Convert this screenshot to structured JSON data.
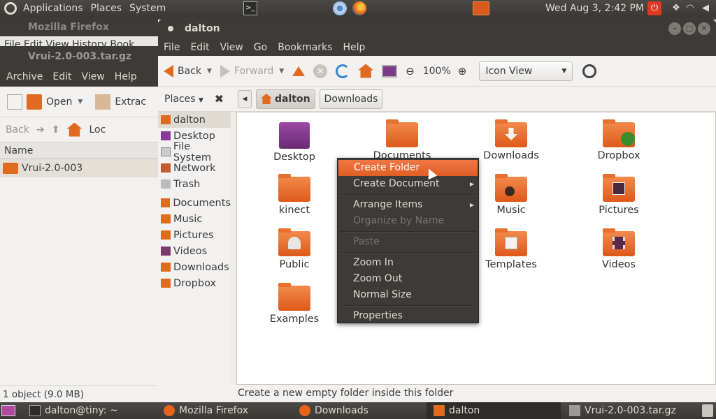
{
  "top_panel": {
    "menus": [
      "Applications",
      "Places",
      "System"
    ],
    "clock": "Wed Aug  3,  2:42 PM",
    "terminal_glyph": ">_",
    "power_glyph": "⏻",
    "tray": [
      "dropbox-icon",
      "wifi-icon",
      "volume-icon"
    ]
  },
  "bg_firefox": {
    "title": "Mozilla Firefox",
    "menu_peek": "File  Edit  View  History  Book"
  },
  "archive": {
    "title": "Vrui-2.0-003.tar.gz",
    "menus": [
      "Archive",
      "Edit",
      "View",
      "Help"
    ],
    "open_label": "Open",
    "extract_label": "Extrac",
    "back_label": "Back",
    "location_label": "Loc",
    "column_name": "Name",
    "row_name": "Vrui-2.0-003",
    "status": "1 object (9.0 MB)"
  },
  "window": {
    "title": "dalton",
    "menus": [
      "File",
      "Edit",
      "View",
      "Go",
      "Bookmarks",
      "Help"
    ],
    "toolbar": {
      "back": "Back",
      "forward": "Forward",
      "zoom": "100%",
      "view_mode": "Icon View"
    },
    "places_label": "Places",
    "breadcrumbs": [
      "dalton",
      "Downloads"
    ],
    "sidebar": [
      {
        "label": "dalton",
        "selected": true
      },
      {
        "label": "Desktop"
      },
      {
        "label": "File System"
      },
      {
        "label": "Network"
      },
      {
        "label": "Trash"
      },
      {
        "label": "Documents"
      },
      {
        "label": "Music"
      },
      {
        "label": "Pictures"
      },
      {
        "label": "Videos"
      },
      {
        "label": "Downloads"
      },
      {
        "label": "Dropbox"
      }
    ],
    "files": [
      "Desktop",
      "Documents",
      "Downloads",
      "Dropbox",
      "kinect",
      "Music",
      "Pictures",
      "Public",
      "Templates",
      "Videos",
      "Examples"
    ],
    "status": "Create a new empty folder inside this folder"
  },
  "context_menu": {
    "items": [
      {
        "label": "Create Folder",
        "state": "highlighted"
      },
      {
        "label": "Create Document",
        "submenu": true
      },
      {
        "label": "Arrange Items",
        "submenu": true
      },
      {
        "label": "Organize by Name",
        "state": "disabled"
      },
      {
        "label": "Paste",
        "state": "disabled"
      },
      {
        "label": "Zoom In"
      },
      {
        "label": "Zoom Out"
      },
      {
        "label": "Normal Size"
      },
      {
        "label": "Properties"
      }
    ]
  },
  "bottom_panel": {
    "tasks": [
      "dalton@tiny: ~",
      "Mozilla Firefox",
      "Downloads",
      "dalton",
      "Vrui-2.0-003.tar.gz"
    ]
  },
  "colors": {
    "accent": "#e06a1f",
    "panel": "#3c3b37",
    "menu_highlight": "#f07746"
  }
}
